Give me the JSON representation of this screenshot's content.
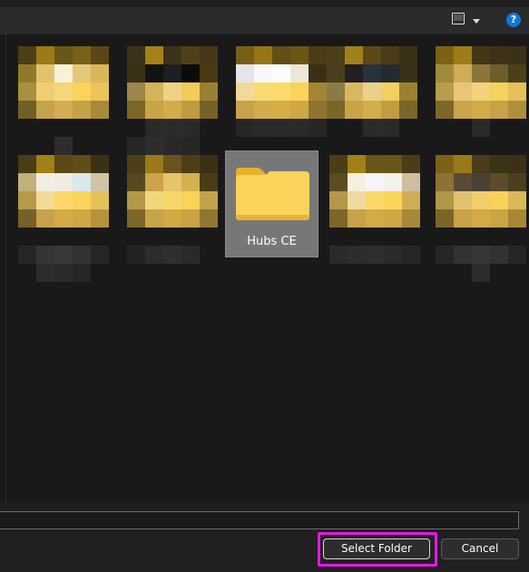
{
  "toolbar": {
    "view_icon": "view-menu-icon",
    "help_icon": "help-icon",
    "help_glyph": "?"
  },
  "folders": {
    "selected": {
      "name": "Hubs CE",
      "icon": "folder-icon"
    }
  },
  "footer": {
    "folder_name_value": "",
    "select_label": "Select Folder",
    "cancel_label": "Cancel"
  },
  "colors": {
    "accent_highlight": "#e815e8",
    "help_blue": "#1177d6",
    "folder_yellow": "#fcd35a"
  }
}
